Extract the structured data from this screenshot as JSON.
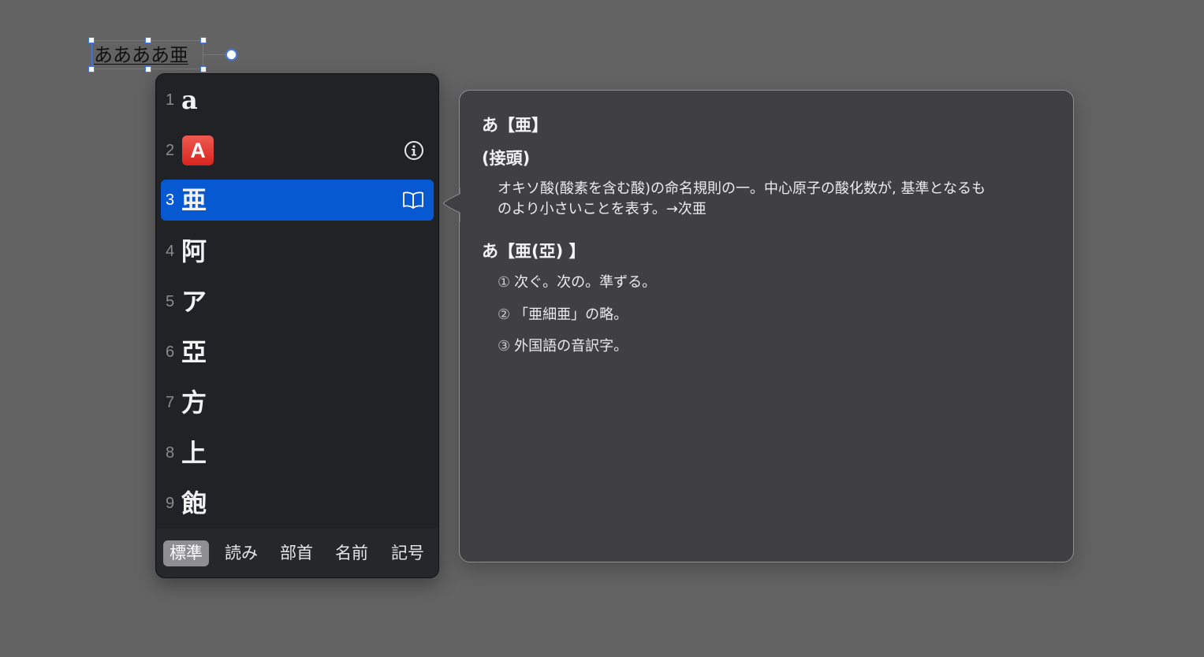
{
  "canvas": {
    "textbox": {
      "text": "ああああ亜"
    }
  },
  "candidates": {
    "items": [
      {
        "num": "1",
        "text": "a",
        "kind": "text"
      },
      {
        "num": "2",
        "text": "A",
        "kind": "emoji",
        "icon": "info-icon"
      },
      {
        "num": "3",
        "text": "亜",
        "kind": "text",
        "selected": true,
        "icon": "book-icon"
      },
      {
        "num": "4",
        "text": "阿",
        "kind": "text"
      },
      {
        "num": "5",
        "text": "ア",
        "kind": "text"
      },
      {
        "num": "6",
        "text": "亞",
        "kind": "text"
      },
      {
        "num": "7",
        "text": "方",
        "kind": "text"
      },
      {
        "num": "8",
        "text": "上",
        "kind": "text"
      },
      {
        "num": "9",
        "text": "飽",
        "kind": "text"
      }
    ],
    "tabs": [
      {
        "label": "標準",
        "active": true
      },
      {
        "label": "読み"
      },
      {
        "label": "部首"
      },
      {
        "label": "名前"
      },
      {
        "label": "記号"
      }
    ],
    "selection_color": "#0659d1"
  },
  "dictionary": {
    "entry1": {
      "headword": "あ【亜】",
      "part_of_speech": "(接頭)",
      "definition_line1": "オキソ酸(酸素を含む酸)の命名規則の一。中心原子の酸化数が, 基準となるも",
      "definition_line2": "のより小さいことを表す。→次亜"
    },
    "entry2": {
      "headword": "あ【亜(亞) 】",
      "senses": [
        {
          "num": "①",
          "text": "次ぐ。次の。準ずる。"
        },
        {
          "num": "②",
          "text": "「亜細亜」の略。"
        },
        {
          "num": "③",
          "text": "外国語の音訳字。"
        }
      ]
    }
  }
}
